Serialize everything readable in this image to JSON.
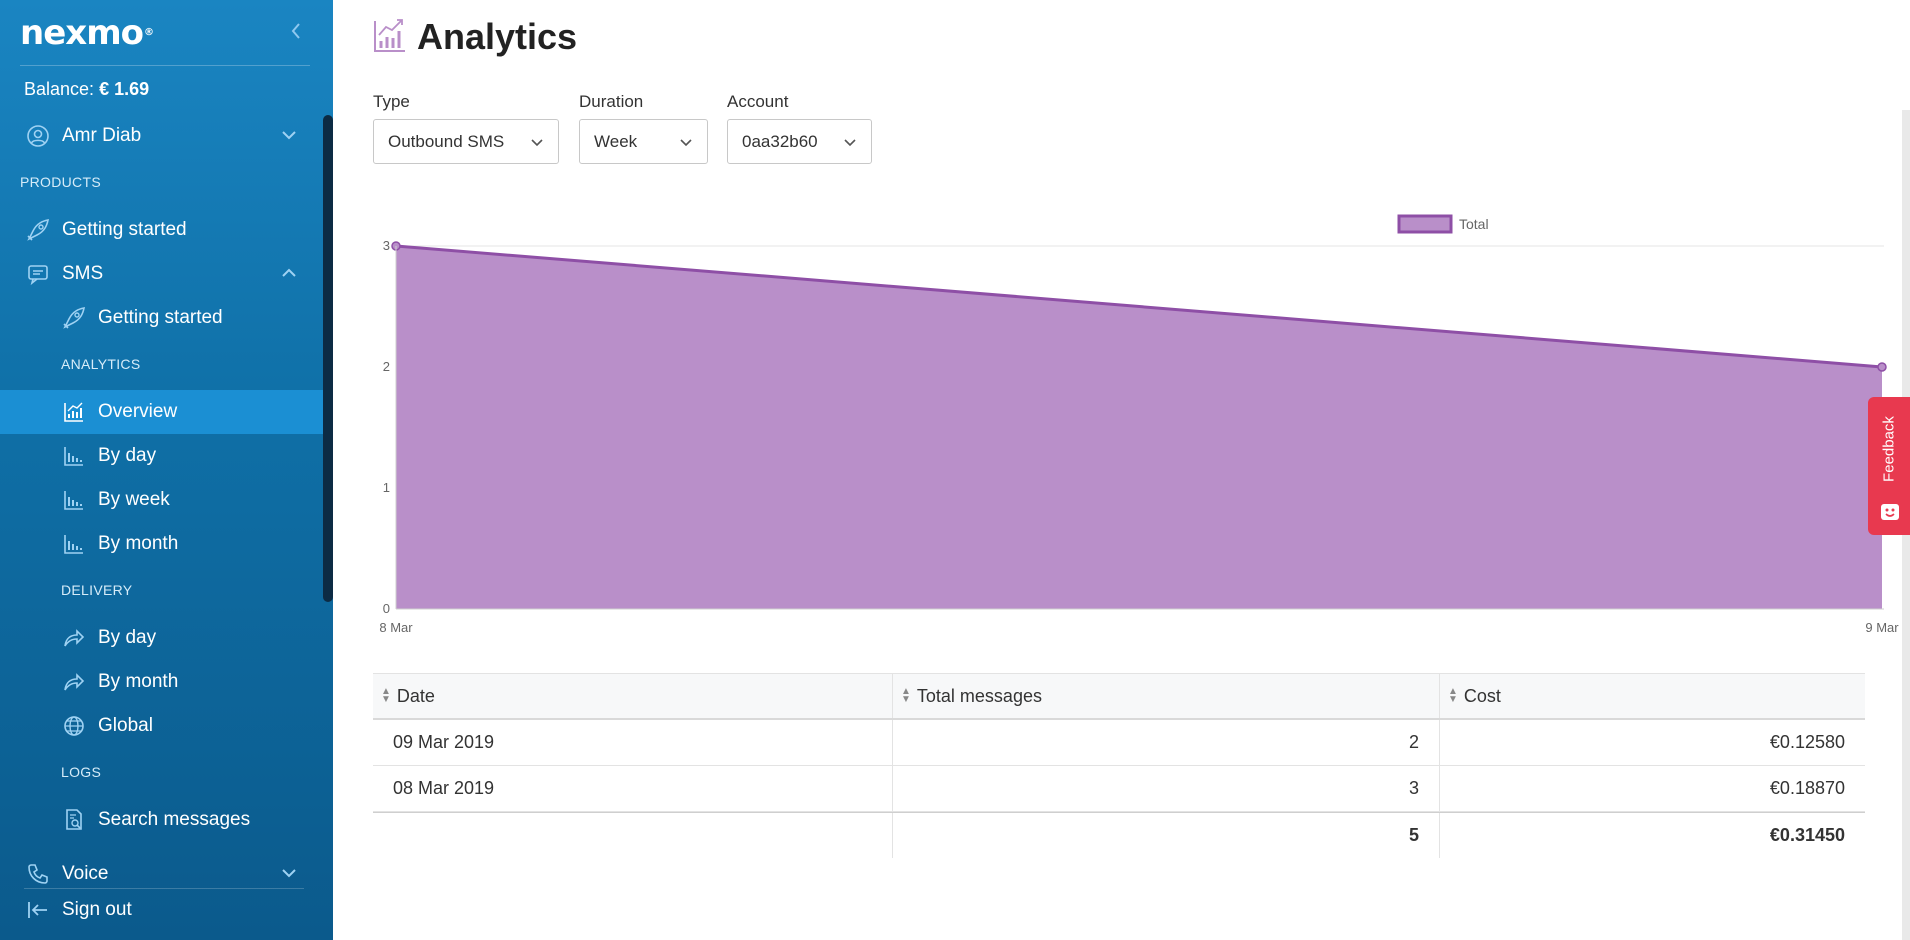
{
  "sidebar": {
    "logo": "nexmo",
    "balance_label": "Balance:",
    "balance_value": "€ 1.69",
    "user_name": "Amr Diab",
    "products_heading": "PRODUCTS",
    "getting_started": "Getting started",
    "sms": "SMS",
    "sms_getting_started": "Getting started",
    "analytics_heading": "ANALYTICS",
    "overview": "Overview",
    "analytics_by_day": "By day",
    "analytics_by_week": "By week",
    "analytics_by_month": "By month",
    "delivery_heading": "DELIVERY",
    "delivery_by_day": "By day",
    "delivery_by_month": "By month",
    "delivery_global": "Global",
    "logs_heading": "LOGS",
    "search_messages": "Search messages",
    "voice": "Voice",
    "sign_out": "Sign out"
  },
  "header": {
    "title": "Analytics"
  },
  "filters": {
    "type_label": "Type",
    "type_value": "Outbound SMS",
    "duration_label": "Duration",
    "duration_value": "Week",
    "account_label": "Account",
    "account_value": "0aa32b60"
  },
  "chart_data": {
    "type": "area",
    "title": "",
    "xlabel": "",
    "ylabel": "",
    "x": [
      "8 Mar",
      "9 Mar"
    ],
    "series": [
      {
        "name": "Total",
        "values": [
          3,
          2
        ],
        "color": "#8e4fa6",
        "fill": "#b98fc9"
      }
    ],
    "ylim": [
      0,
      3
    ],
    "yticks": [
      0,
      1,
      2,
      3
    ],
    "grid": true,
    "legend": "top-center"
  },
  "table": {
    "headers": {
      "date": "Date",
      "total": "Total messages",
      "cost": "Cost"
    },
    "rows": [
      {
        "date": "09 Mar 2019",
        "total": "2",
        "cost": "€0.12580"
      },
      {
        "date": "08 Mar 2019",
        "total": "3",
        "cost": "€0.18870"
      }
    ],
    "totals": {
      "total": "5",
      "cost": "€0.31450"
    }
  },
  "feedback": "Feedback",
  "colors": {
    "sidebar": "#0f6fa6",
    "active": "#1b8fd3",
    "accent": "#b98fc9",
    "feedback": "#e8394f"
  },
  "icons": {
    "user": "user-circle-icon",
    "rocket": "rocket-icon",
    "sms": "chat-icon",
    "overview": "line-chart-icon",
    "bar": "bar-chart-icon",
    "share": "share-arrow-icon",
    "globe": "globe-icon",
    "search_doc": "search-document-icon",
    "phone": "phone-icon",
    "signout": "sign-out-icon"
  }
}
